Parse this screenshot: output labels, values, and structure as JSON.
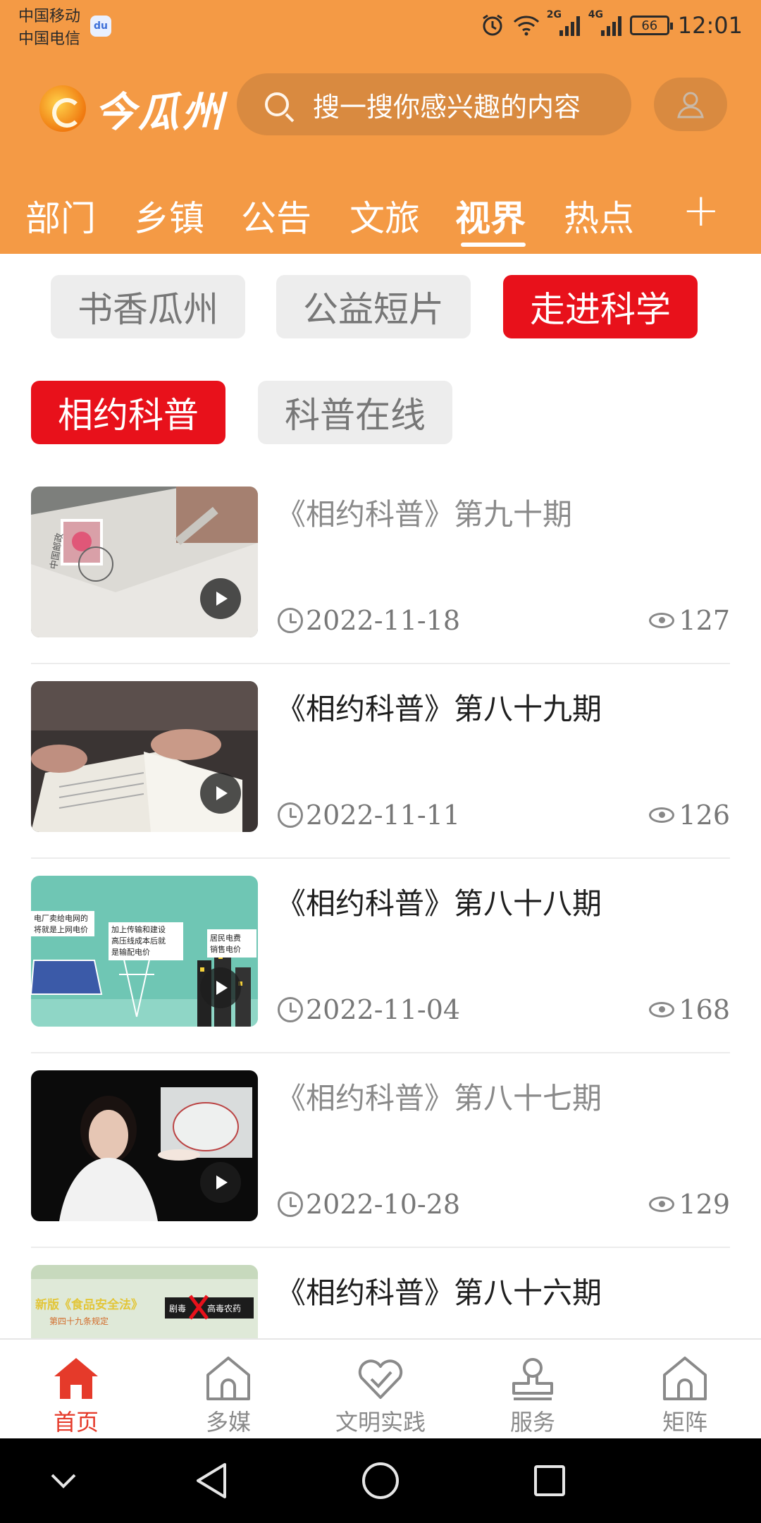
{
  "status_bar": {
    "carrier_1": "中国移动",
    "carrier_2": "中国电信",
    "network_1": "2G",
    "network_2": "4G",
    "battery": "66",
    "time": "12:01"
  },
  "header": {
    "logo_text": "今瓜州",
    "search_placeholder": "搜一搜你感兴趣的内容",
    "tabs": [
      {
        "label": "部门"
      },
      {
        "label": "乡镇"
      },
      {
        "label": "公告"
      },
      {
        "label": "文旅"
      },
      {
        "label": "视界"
      },
      {
        "label": "热点"
      }
    ],
    "active_tab": "视界",
    "add_tab_symbol": "+"
  },
  "sub_categories": [
    {
      "label": "书香瓜州",
      "selected": false
    },
    {
      "label": "公益短片",
      "selected": false
    },
    {
      "label": "走进科学",
      "selected": true
    }
  ],
  "sub_sub_categories": [
    {
      "label": "相约科普",
      "selected": true
    },
    {
      "label": "科普在线",
      "selected": false
    }
  ],
  "videos": [
    {
      "title": "《相约科普》第九十期",
      "date": "2022-11-18",
      "views": "127",
      "read": true
    },
    {
      "title": "《相约科普》第八十九期",
      "date": "2022-11-11",
      "views": "126",
      "read": false
    },
    {
      "title": "《相约科普》第八十八期",
      "date": "2022-11-04",
      "views": "168",
      "read": false
    },
    {
      "title": "《相约科普》第八十七期",
      "date": "2022-10-28",
      "views": "129",
      "read": true
    },
    {
      "title": "《相约科普》第八十六期",
      "date": "",
      "views": "",
      "read": false
    }
  ],
  "thumb_texts": {
    "v1_stamp": "中国邮政",
    "v3_a": "电厂卖给电网的",
    "v3_b": "将就是上网电价",
    "v3_c": "加上传输和建设",
    "v3_d": "高压线成本后就",
    "v3_e": "是输配电价",
    "v3_f": "居民电费",
    "v3_g": "销售电价",
    "v5_a": "新版《食品安全法》",
    "v5_b": "第四十九条规定",
    "v5_c": "剧毒",
    "v5_d": "高毒农药"
  },
  "bottom_nav": [
    {
      "label": "首页",
      "active": true
    },
    {
      "label": "多媒",
      "active": false
    },
    {
      "label": "文明实践",
      "active": false
    },
    {
      "label": "服务",
      "active": false
    },
    {
      "label": "矩阵",
      "active": false
    }
  ],
  "colors": {
    "brand_orange": "#f49a45",
    "accent_red": "#e8111b",
    "active_nav_red": "#e53a2a"
  }
}
